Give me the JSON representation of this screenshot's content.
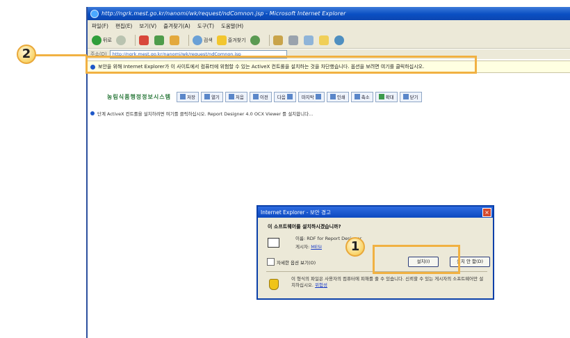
{
  "browser": {
    "title": "http://ngrk.mest.go.kr/nanomi/wk/request/ndComnon.jsp - Microsoft Internet Explorer",
    "menu": [
      "파일(F)",
      "편집(E)",
      "보기(V)",
      "즐겨찾기(A)",
      "도구(T)",
      "도움말(H)"
    ],
    "toolbar": {
      "back_label": "뒤로",
      "search_label": "검색",
      "favorites_label": "즐겨찾기"
    },
    "address_label": "주소(D)",
    "address_value": "http://ngrk.mest.go.kr/nanomi/wk/request/ndComnon.jsp",
    "infobar_text": "보안을 위해 Internet Explorer가 이 사이트에서 컴퓨터에 위험할 수 있는 ActiveX 컨트롤을 설치하는 것을 차단했습니다. 옵션을 보려면 여기를 클릭하십시오."
  },
  "page": {
    "site_logo": "농림식품행정정보시스템",
    "buttons": [
      "저장",
      "열기",
      "처음",
      "이전",
      "다음",
      "마지막",
      "인쇄",
      "축소",
      "확대",
      "닫기"
    ],
    "message": "단계 ActiveX 컨트롤을 설치하려면 여기를 클릭하십시오. Report Designer 4.0 OCX Viewer 를 설치합니다..."
  },
  "dialog": {
    "title": "Internet Explorer - 보안 경고",
    "close": "×",
    "question": "이 소프트웨어를 설치하시겠습니까?",
    "name_label": "이름:",
    "name_value": "RDF for Report Designer",
    "publisher_label": "게시자:",
    "publisher_value": "MESI",
    "more_options": "자세한 옵션 보기(O)",
    "install_label": "설치(I)",
    "no_install_label": "설치 안 함(D)",
    "warning_text": "이 형식의 파일은 사용자의 컴퓨터에 피해를 줄 수 있습니다. 신뢰할 수 있는 게시자의 소프트웨어만 설치하십시오.",
    "warning_link": "위험성"
  },
  "annotations": {
    "callout_1": "1",
    "callout_2": "2"
  },
  "colors": {
    "callout_orange": "#f1b142",
    "titlebar_blue": "#0a4fc3",
    "infobar_yellow": "#ffffe1"
  }
}
